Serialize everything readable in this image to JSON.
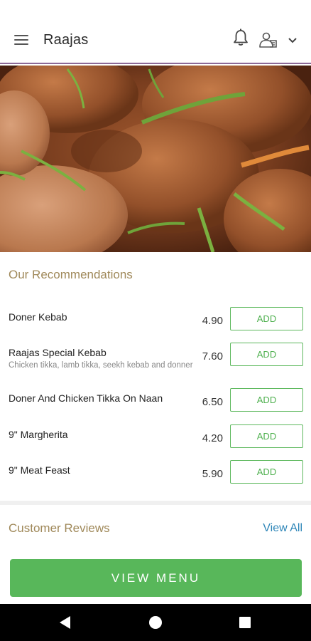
{
  "header": {
    "title": "Raajas",
    "icons": [
      "menu-icon",
      "bell-icon",
      "user-icon",
      "chevron-down-icon"
    ]
  },
  "hero": {
    "image": "food-photo"
  },
  "recommendations": {
    "title": "Our Recommendations",
    "items": [
      {
        "name": "Doner Kebab",
        "description": "",
        "price": "4.90",
        "button": "ADD"
      },
      {
        "name": "Raajas Special Kebab",
        "description": "Chicken tikka, lamb tikka, seekh kebab and donner",
        "price": "7.60",
        "button": "ADD"
      },
      {
        "name": "Doner And Chicken Tikka On Naan",
        "description": "",
        "price": "6.50",
        "button": "ADD"
      },
      {
        "name": "9\" Margherita",
        "description": "",
        "price": "4.20",
        "button": "ADD"
      },
      {
        "name": "9\" Meat Feast",
        "description": "",
        "price": "5.90",
        "button": "ADD"
      }
    ]
  },
  "reviews": {
    "title": "Customer Reviews",
    "view_all": "View All"
  },
  "cta": {
    "label": "VIEW MENU"
  },
  "colors": {
    "accent_green": "#58b75a",
    "section_title": "#a0895a",
    "link_blue": "#2e86b8",
    "header_border": "#8c6a98"
  }
}
